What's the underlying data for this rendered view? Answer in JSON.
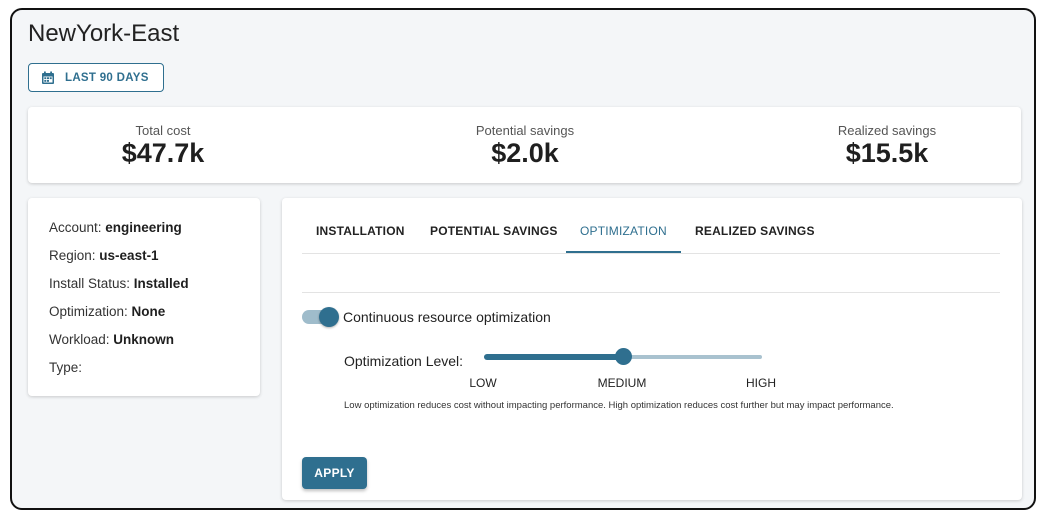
{
  "page_title": "NewYork-East",
  "date_range": {
    "label": "LAST 90 DAYS",
    "icon": "calendar-icon"
  },
  "stats": [
    {
      "label": "Total cost",
      "value": "$47.7k"
    },
    {
      "label": "Potential savings",
      "value": "$2.0k"
    },
    {
      "label": "Realized savings",
      "value": "$15.5k"
    }
  ],
  "info": [
    {
      "label": "Account: ",
      "value": "engineering"
    },
    {
      "label": "Region: ",
      "value": "us-east-1"
    },
    {
      "label": "Install Status: ",
      "value": "Installed"
    },
    {
      "label": "Optimization: ",
      "value": "None"
    },
    {
      "label": "Workload: ",
      "value": "Unknown"
    },
    {
      "label": "Type:",
      "value": ""
    }
  ],
  "tabs": [
    {
      "label": "INSTALLATION",
      "active": false
    },
    {
      "label": "POTENTIAL SAVINGS",
      "active": false
    },
    {
      "label": "OPTIMIZATION",
      "active": true
    },
    {
      "label": "REALIZED SAVINGS",
      "active": false
    }
  ],
  "optimization": {
    "toggle_label": "Continuous resource optimization",
    "toggle_on": true,
    "level_label": "Optimization Level:",
    "level_marks": [
      "LOW",
      "MEDIUM",
      "HIGH"
    ],
    "level_value": "MEDIUM",
    "level_fraction": 0.5,
    "help_text": "Low optimization reduces cost without impacting performance. High optimization reduces cost further but may impact performance.",
    "apply_label": "APPLY"
  },
  "colors": {
    "accent": "#2f6f8f",
    "accent_light": "#a9c2cf",
    "background": "#f4f6f8"
  }
}
